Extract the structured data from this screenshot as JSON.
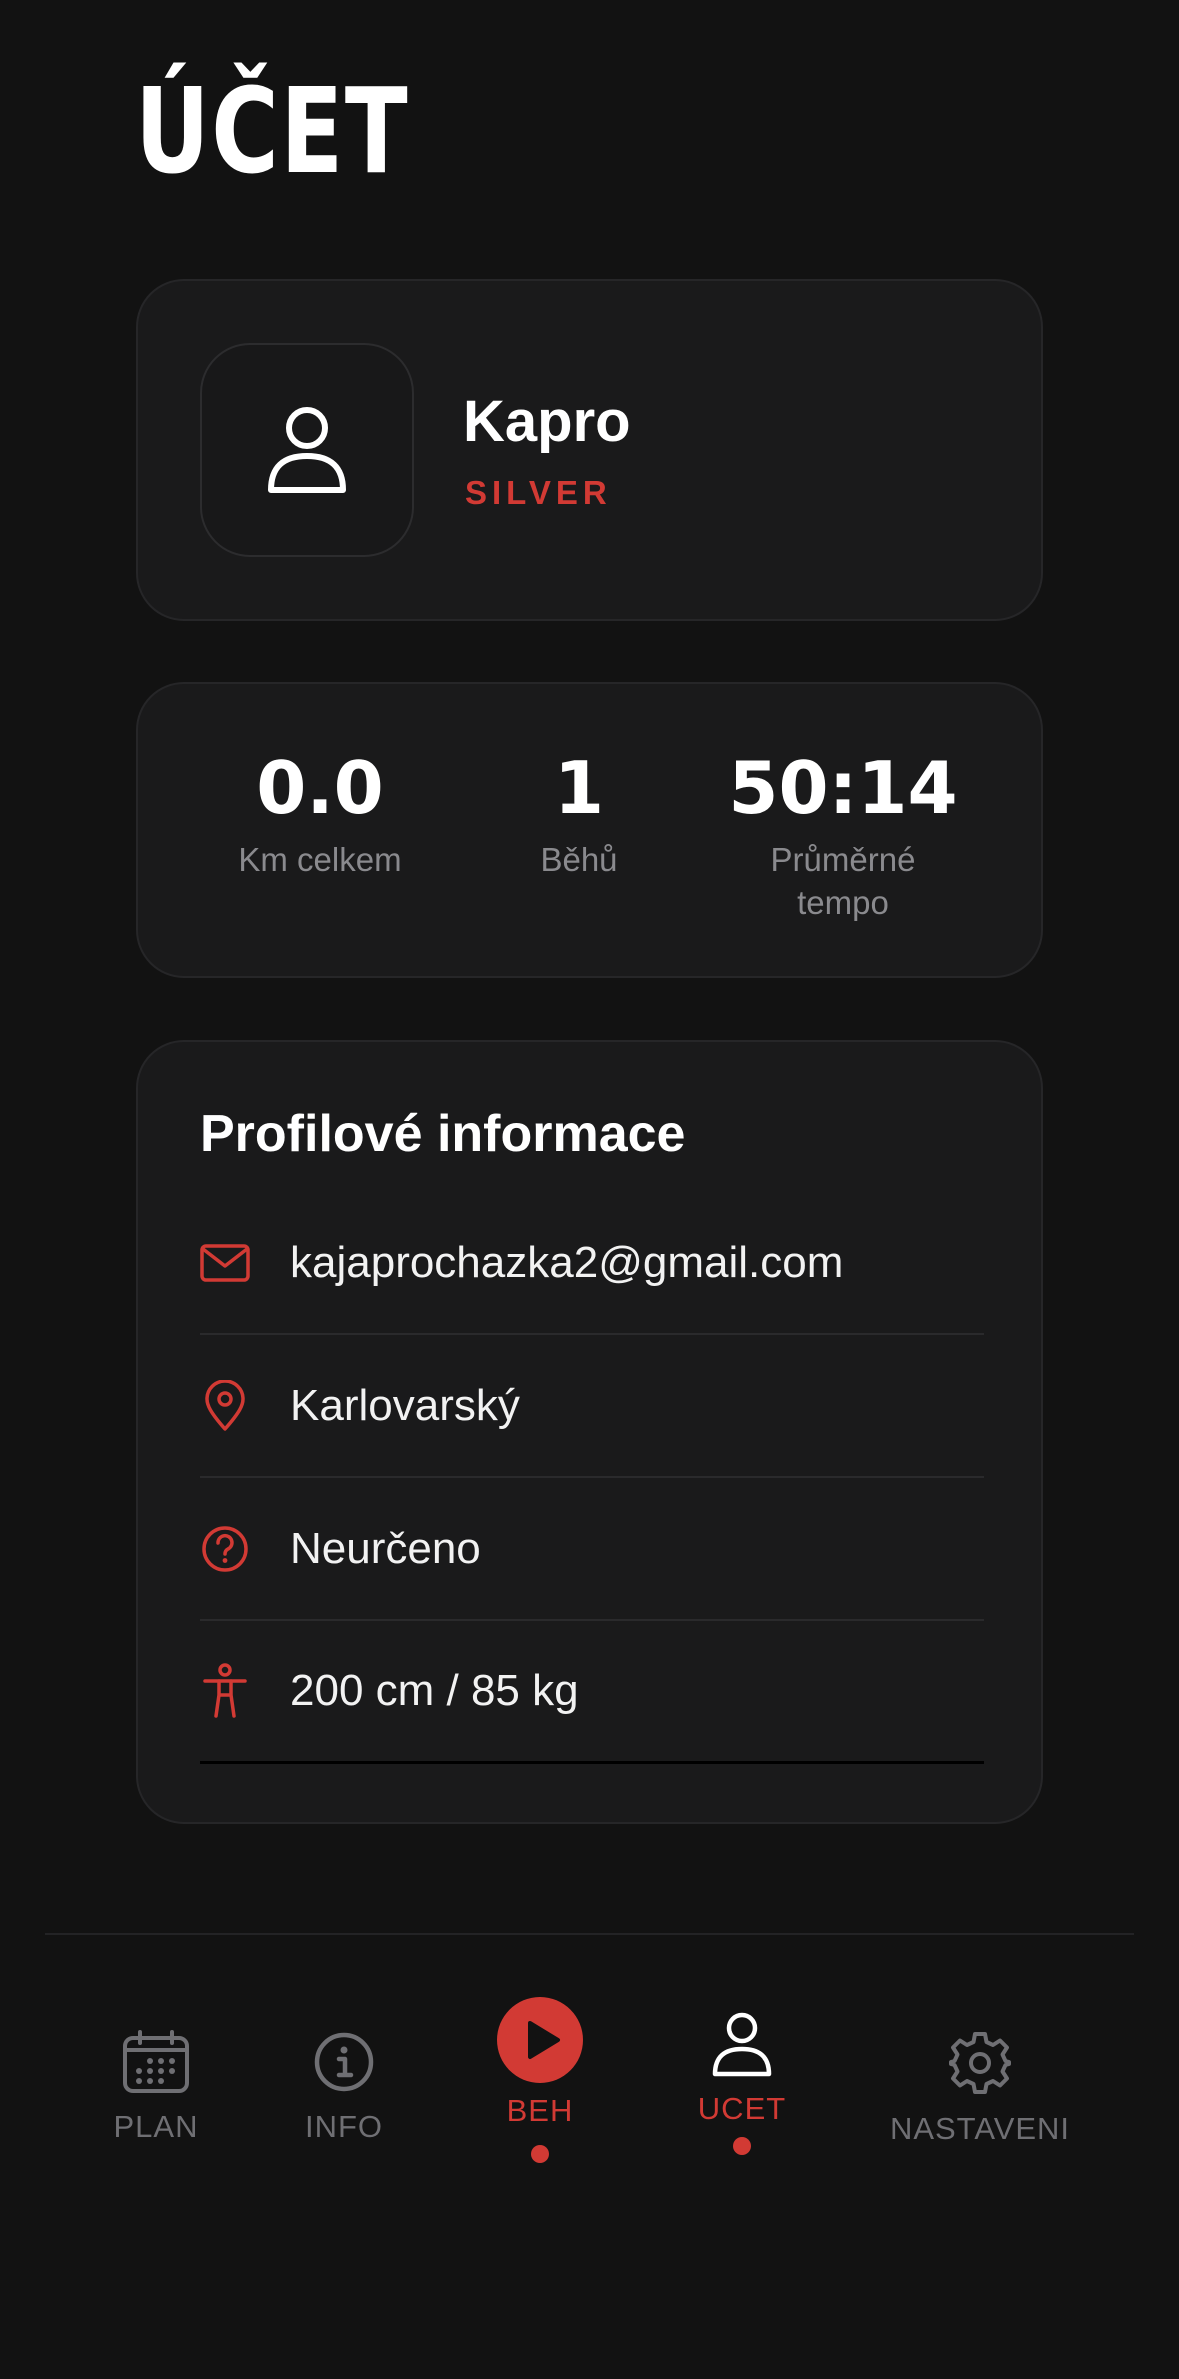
{
  "header": {
    "title": "ÚČET"
  },
  "profile": {
    "name": "Kapro",
    "tier": "SILVER"
  },
  "stats": [
    {
      "value": "0.0",
      "label": "Km celkem"
    },
    {
      "value": "1",
      "label": "Běhů"
    },
    {
      "value": "50:14",
      "label": "Průměrné tempo"
    }
  ],
  "info": {
    "title": "Profilové informace",
    "rows": [
      {
        "icon": "mail-icon",
        "text": "kajaprochazka2@gmail.com"
      },
      {
        "icon": "location-pin-icon",
        "text": "Karlovarský"
      },
      {
        "icon": "question-circle-icon",
        "text": "Neurčeno"
      },
      {
        "icon": "body-icon",
        "text": "200 cm / 85 kg"
      }
    ]
  },
  "nav": {
    "items": [
      {
        "label": "PLAN",
        "icon": "calendar-icon"
      },
      {
        "label": "INFO",
        "icon": "info-icon"
      },
      {
        "label": "BEH",
        "icon": "play-icon"
      },
      {
        "label": "UCET",
        "icon": "user-icon"
      },
      {
        "label": "NASTAVENI",
        "icon": "gear-icon"
      }
    ],
    "active": "UCET"
  },
  "colors": {
    "accent": "#d23a34",
    "background": "#121212",
    "card": "#1a1a1b",
    "muted": "#8a8a8e"
  }
}
